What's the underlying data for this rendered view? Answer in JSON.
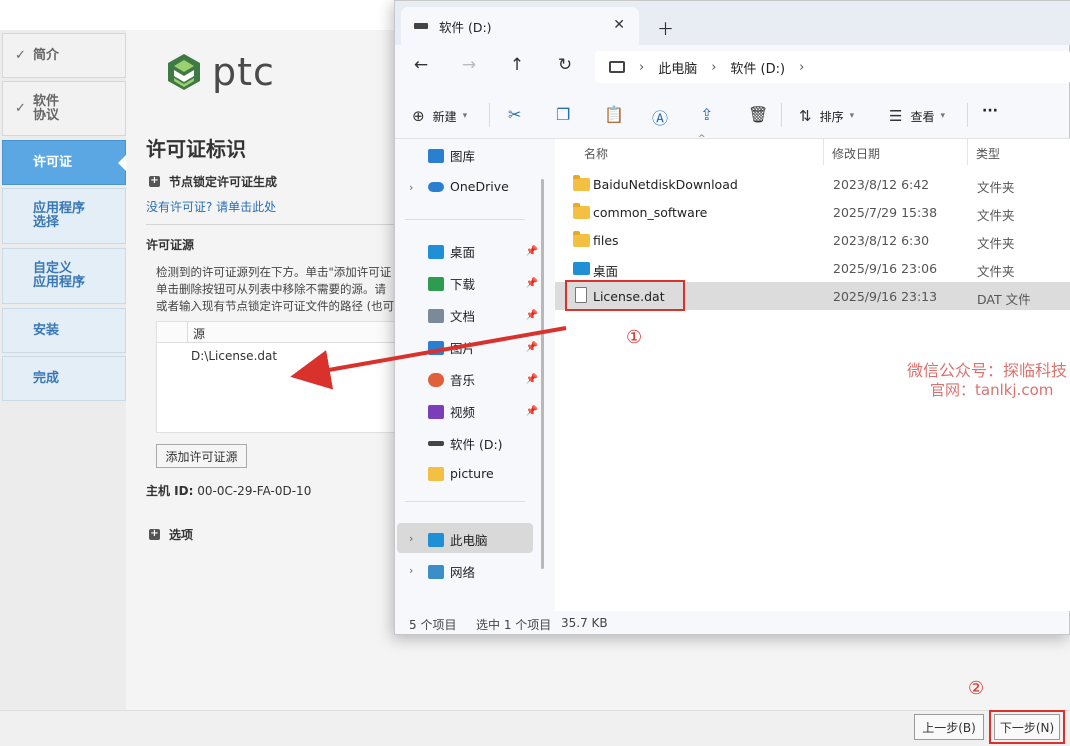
{
  "installer": {
    "steps": [
      {
        "label": "简介",
        "state": "done"
      },
      {
        "label": "软件\n协议",
        "state": "done"
      },
      {
        "label": "许可证",
        "state": "active"
      },
      {
        "label": "应用程序\n选择",
        "state": "pending"
      },
      {
        "label": "自定义\n应用程序",
        "state": "pending"
      },
      {
        "label": "安装",
        "state": "pending"
      },
      {
        "label": "完成",
        "state": "pending"
      }
    ],
    "logo_text": "ptc",
    "page_title": "许可证标识",
    "node_locked_expander": "节点锁定许可证生成",
    "no_license_link": "没有许可证? 请单击此处",
    "source_heading": "许可证源",
    "description_lines": [
      "检测到的许可证源列在下方。单击\"添加许可证",
      "单击删除按钮可从列表中移除不需要的源。请",
      "或者输入现有节点锁定许可证文件的路径 (也可"
    ],
    "source_table": {
      "column_header": "源",
      "rows": [
        "D:\\License.dat"
      ]
    },
    "add_source_button": "添加许可证源",
    "host_id_label": "主机 ID:",
    "host_id_value": "00-0C-29-FA-0D-10",
    "options_expander": "选项",
    "back_button": "上一步(B)",
    "next_button": "下一步(N)"
  },
  "explorer": {
    "tab_title": "软件 (D:)",
    "breadcrumb": [
      "此电脑",
      "软件 (D:)"
    ],
    "toolbar": {
      "new_label": "新建",
      "sort_label": "排序",
      "view_label": "查看",
      "more_label": "···"
    },
    "nav": {
      "gallery": "图库",
      "onedrive": "OneDrive",
      "quick_access": [
        {
          "label": "桌面",
          "color": "#1f8fd6"
        },
        {
          "label": "下载",
          "color": "#2e9b4e"
        },
        {
          "label": "文档",
          "color": "#7a8a9a"
        },
        {
          "label": "图片",
          "color": "#2b7fd1"
        },
        {
          "label": "音乐",
          "color": "#e0603a"
        },
        {
          "label": "视频",
          "color": "#7a3fb8"
        },
        {
          "label": "软件 (D:)",
          "color": "#444444"
        },
        {
          "label": "picture",
          "color": "#f4c043"
        }
      ],
      "this_pc": "此电脑",
      "network": "网络"
    },
    "columns": [
      "名称",
      "修改日期",
      "类型"
    ],
    "files": [
      {
        "name": "BaiduNetdiskDownload",
        "date": "2023/8/12 6:42",
        "type": "文件夹",
        "icon": "folder"
      },
      {
        "name": "common_software",
        "date": "2025/7/29 15:38",
        "type": "文件夹",
        "icon": "folder"
      },
      {
        "name": "files",
        "date": "2023/8/12 6:30",
        "type": "文件夹",
        "icon": "folder"
      },
      {
        "name": "桌面",
        "date": "2025/9/16 23:06",
        "type": "文件夹",
        "icon": "desktop"
      },
      {
        "name": "License.dat",
        "date": "2025/9/16 23:13",
        "type": "DAT 文件",
        "icon": "file",
        "selected": true
      }
    ],
    "status": {
      "count": "5 个项目",
      "selected": "选中 1 个项目",
      "size": "35.7 KB"
    }
  },
  "annotations": {
    "marker1": "①",
    "marker2": "②",
    "accent_color": "#d9312c",
    "watermark_line1": "微信公众号：探临科技",
    "watermark_line2": "官网：tanlkj.com"
  }
}
